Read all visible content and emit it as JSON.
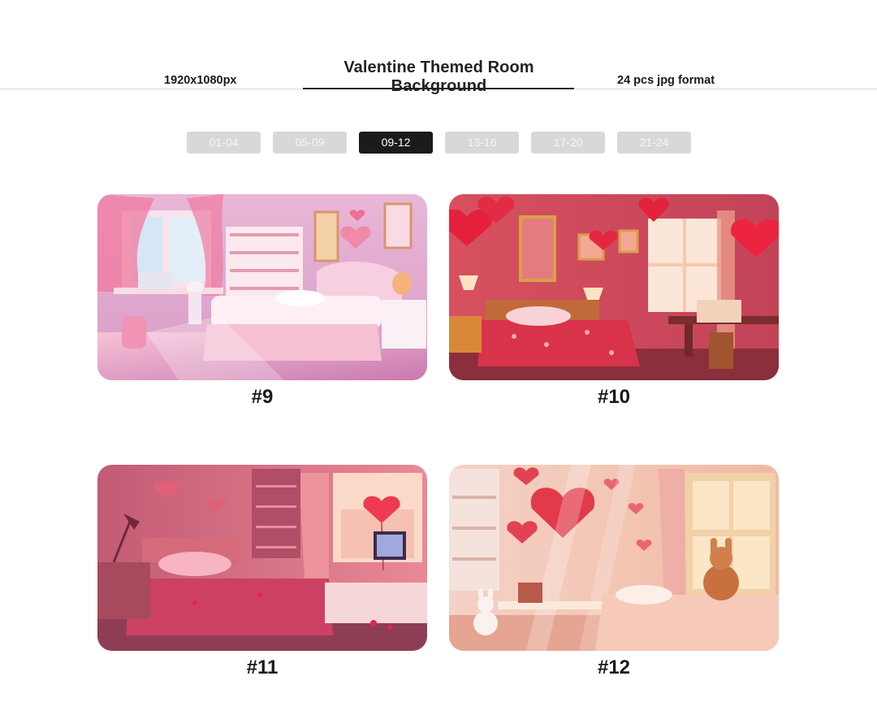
{
  "header": {
    "title": "Valentine Themed Room Background",
    "resolution": "1920x1080px",
    "count_format": "24 pcs jpg format"
  },
  "pagination": {
    "pages": [
      "01-04",
      "05-09",
      "09-12",
      "13-16",
      "17-20",
      "21-24"
    ],
    "active_index": 2
  },
  "gallery": {
    "items": [
      {
        "caption": "#9",
        "subject": "pastel pink bedroom"
      },
      {
        "caption": "#10",
        "subject": "red bedroom with heart balloons"
      },
      {
        "caption": "#11",
        "subject": "rose bedroom with heart balloon"
      },
      {
        "caption": "#12",
        "subject": "cream bedroom with bunny plush"
      }
    ]
  },
  "colors": {
    "active_page": "#1c1a1b",
    "inactive_page": "#d7d9d9",
    "divider": "#d9d9d9"
  }
}
